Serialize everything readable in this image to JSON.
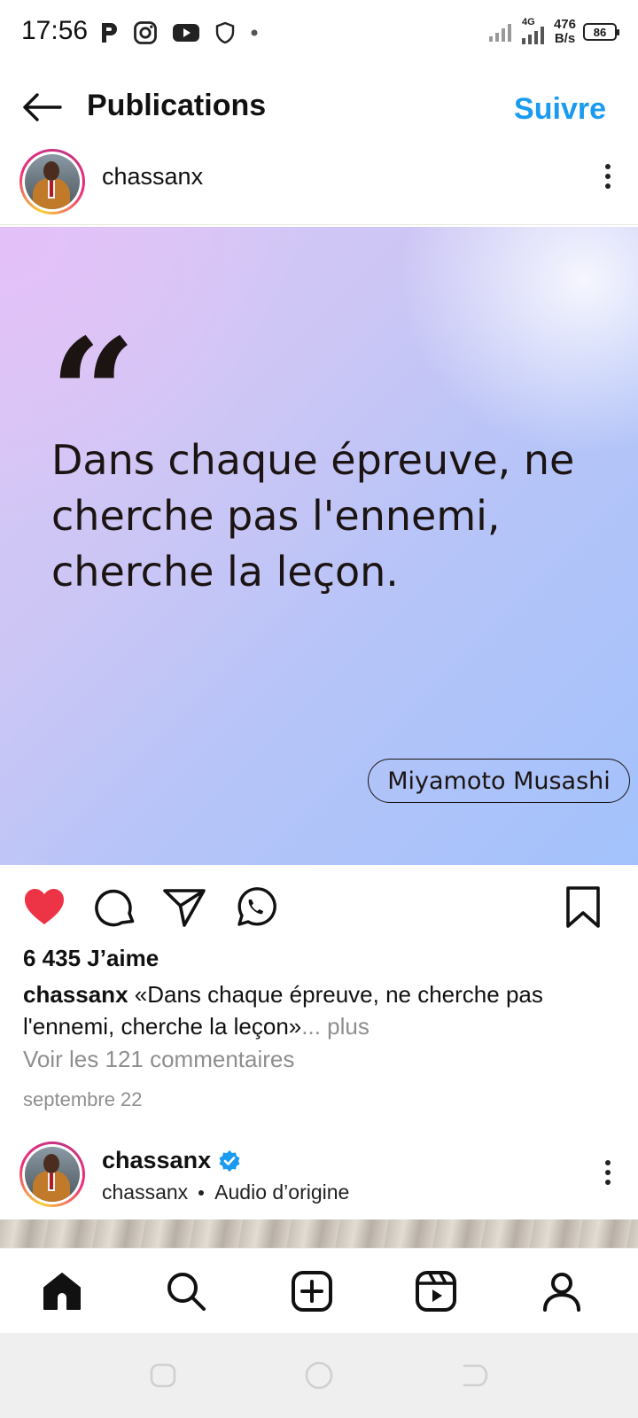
{
  "status_bar": {
    "time": "17:56",
    "network": "4G",
    "speed_value": "476",
    "speed_unit": "B/s",
    "battery": "86"
  },
  "header": {
    "title": "Publications",
    "follow_label": "Suivre"
  },
  "post": {
    "username": "chassanx",
    "quote_mark": "“",
    "quote_line1": "Dans chaque épreuve, ne",
    "quote_line2": "cherche pas l'ennemi,",
    "quote_line3": "cherche la leçon.",
    "author": "Miyamoto Musashi",
    "likes": "6 435 J’aime",
    "caption_user": "chassanx",
    "caption_text": "«Dans chaque épreuve, ne cherche pas l'ennemi, cherche la leçon»",
    "caption_more": "... plus",
    "comments_link": "Voir les 121 commentaires",
    "date": "septembre 22",
    "liked": true,
    "accent_color": "#1a9bf0",
    "like_color": "#ed3446"
  },
  "next_post": {
    "username": "chassanx",
    "sub_user": "chassanx",
    "audio": "Audio d’origine",
    "verified": true
  },
  "icons": {
    "action_bar": [
      "heart-icon",
      "comment-icon",
      "share-icon",
      "whatsapp-icon",
      "bookmark-icon"
    ],
    "bottom_nav": [
      "home-icon",
      "search-icon",
      "create-icon",
      "reels-icon",
      "profile-icon"
    ]
  }
}
